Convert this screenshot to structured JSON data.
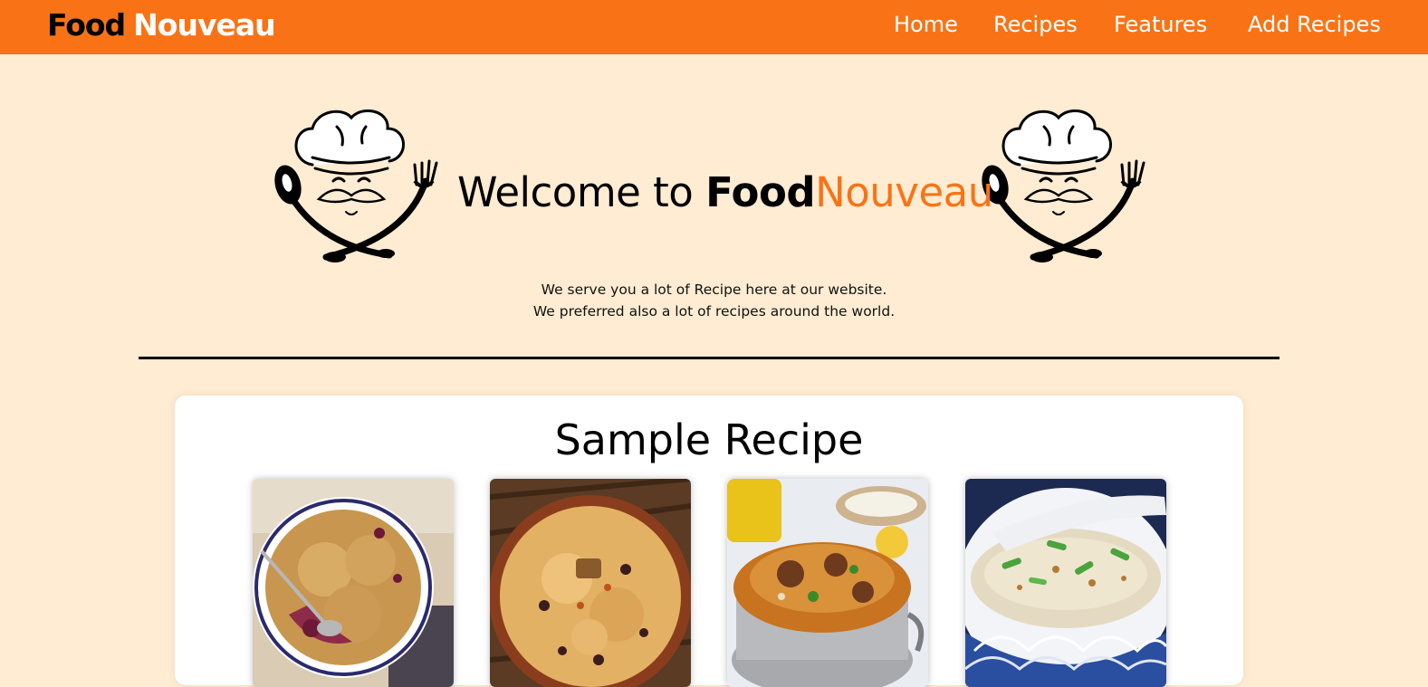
{
  "navbar": {
    "brand": {
      "part1": "Food",
      "part2": "Nouveau"
    },
    "links": [
      {
        "label": "Home"
      },
      {
        "label": "Recipes"
      },
      {
        "label": "Features"
      },
      {
        "label": "Add Recipes"
      }
    ],
    "background": "#f97316"
  },
  "hero": {
    "title_prefix": "Welcome to ",
    "title_food": "Food",
    "title_nouveau": "Nouveau",
    "logo_icon": "chef-logo-icon",
    "tagline_line1": "We serve you a lot of Recipe here at our website.",
    "tagline_line2": "We preferred also a lot of recipes around the world."
  },
  "sample": {
    "title": "Sample Recipe",
    "images": [
      {
        "name": "berry-crumble-image"
      },
      {
        "name": "rice-pilaf-image"
      },
      {
        "name": "biryani-image"
      },
      {
        "name": "congee-image"
      }
    ]
  },
  "colors": {
    "accent": "#f97316",
    "page_background": "#ffecd2",
    "card_background": "#ffffff"
  }
}
